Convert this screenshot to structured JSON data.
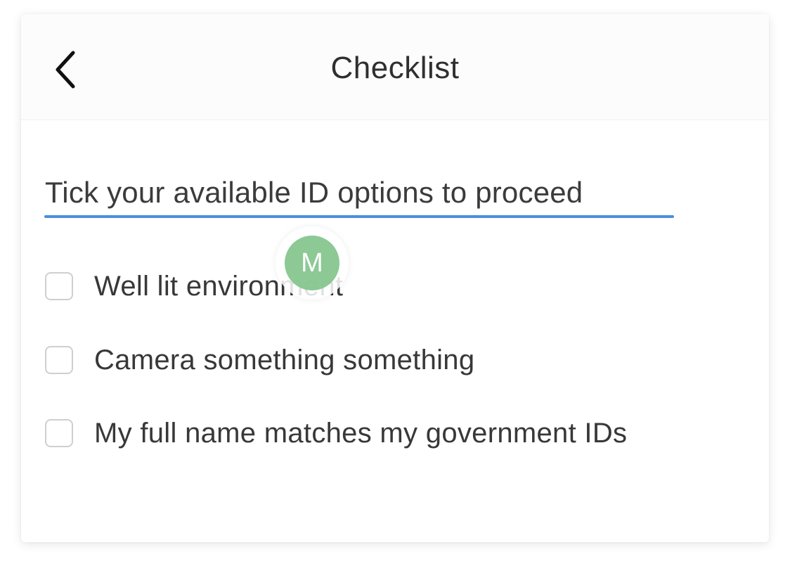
{
  "header": {
    "title": "Checklist",
    "back_icon": "chevron-left-icon"
  },
  "instruction": {
    "text": "Tick your available ID options to proceed",
    "underline_color": "#4a8fe0"
  },
  "checklist": {
    "items": [
      {
        "label": "Well lit environment",
        "checked": false
      },
      {
        "label": "Camera something something",
        "checked": false
      },
      {
        "label": "My full name matches my government IDs",
        "checked": false
      }
    ]
  },
  "avatar": {
    "initial": "M",
    "color": "#82c48c"
  }
}
